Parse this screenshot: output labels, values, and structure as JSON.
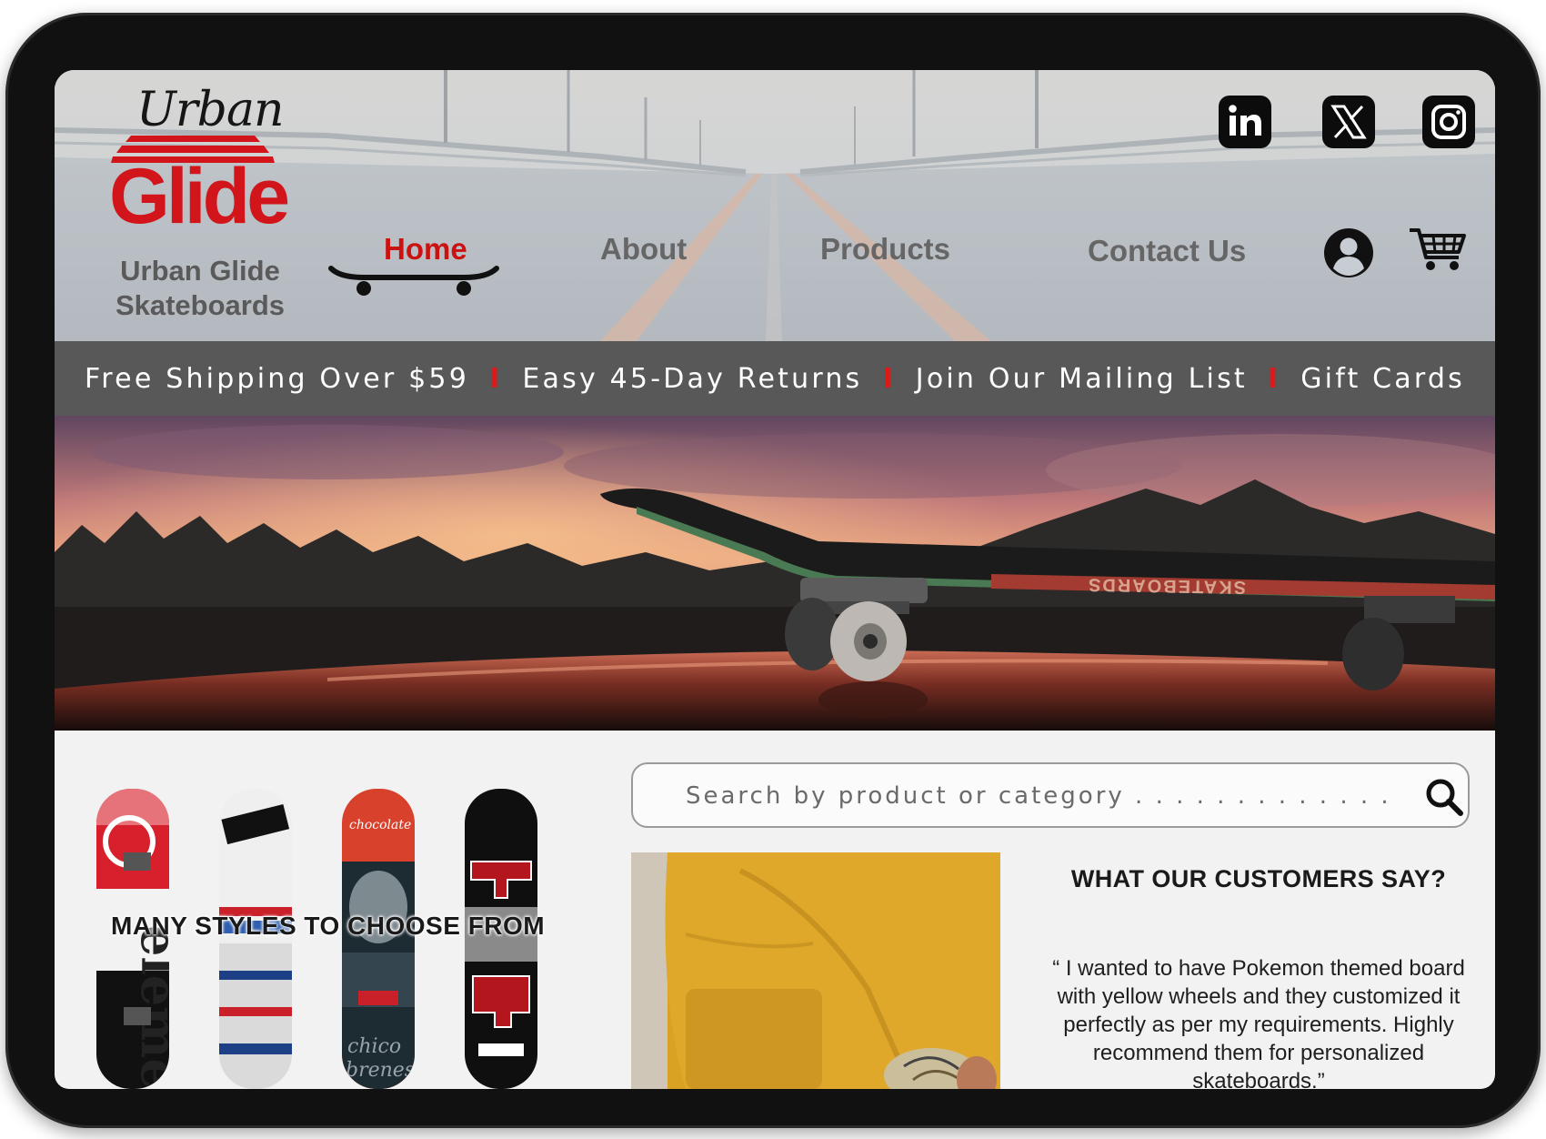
{
  "brand": {
    "logo_word1": "Urban",
    "logo_word2": "Glide",
    "name_line1": "Urban Glide",
    "name_line2": "Skateboards",
    "accent": "#cc1111"
  },
  "nav": {
    "home": "Home",
    "about": "About",
    "products": "Products",
    "contact": "Contact Us",
    "active": "Home"
  },
  "social": {
    "linkedin_icon": "linkedin-icon",
    "x_icon": "x-icon",
    "instagram_icon": "instagram-icon"
  },
  "header_icons": {
    "account": "account-icon",
    "cart": "cart-icon"
  },
  "promo": {
    "item1": "Free Shipping Over $59",
    "item2": "Easy 45-Day Returns",
    "item3": "Join Our Mailing List",
    "item4": "Gift Cards",
    "separator": "I"
  },
  "products_section": {
    "label": "MANY STYLES TO CHOOSE FROM"
  },
  "search": {
    "placeholder": "Search by product or category . . . . . . . . . . . . . . ."
  },
  "reviews": {
    "title": "WHAT OUR CUSTOMERS SAY?",
    "quote": "“ I wanted to have Pokemon themed board with yellow wheels and they customized it perfectly as per my requirements. Highly recommend them for personalized skateboards.”"
  },
  "colors": {
    "promo_bg": "#585858",
    "header_bg": "#c7cdd3",
    "frame": "#111111"
  }
}
